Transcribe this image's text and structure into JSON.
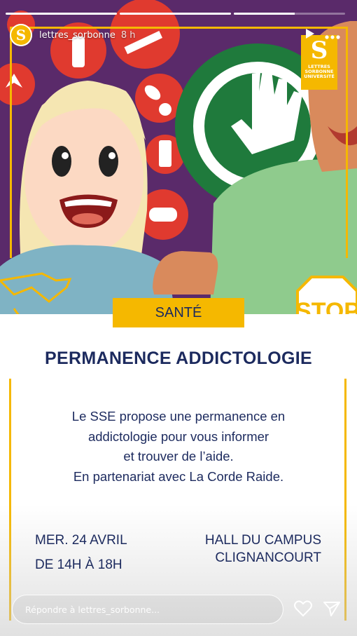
{
  "story": {
    "progress": [
      1,
      1,
      0.55
    ],
    "username": "lettres_sorbonne",
    "time": "8 h",
    "avatar_letter": "S"
  },
  "brand": {
    "letter": "S",
    "line1": "LETTRES",
    "line2": "SORBONNE",
    "line3": "UNIVERSITÉ"
  },
  "illustration": {
    "stop_sign_text": "STOP"
  },
  "content": {
    "tag": "SANTÉ",
    "title": "PERMANENCE ADDICTOLOGIE",
    "description": [
      "Le SSE propose une permanence en",
      "addictologie pour vous informer",
      "et trouver de l’aide.",
      "En partenariat avec La Corde Raide."
    ],
    "date": "MER. 24 AVRIL",
    "hours": "DE 14H À 18H",
    "place_line1": "HALL DU CAMPUS",
    "place_line2": "CLIGNANCOURT"
  },
  "reply": {
    "placeholder": "Répondre à lettres_sorbonne..."
  },
  "colors": {
    "yellow": "#f5b800",
    "navy": "#1c2a5e",
    "purple": "#5a2a6a",
    "red_icons": "#e03a2f",
    "green": "#1f7a3c"
  }
}
